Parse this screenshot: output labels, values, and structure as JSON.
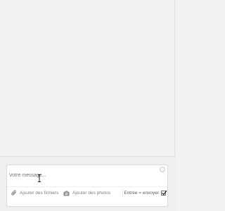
{
  "composer": {
    "message_placeholder": "Votre message...",
    "attach_label": "Ajouter des fichiers",
    "photo_label": "Ajouter des photos",
    "enter_to_send_label": "Entrée = envoyer",
    "enter_to_send_checked": true
  },
  "icons": {
    "attach": "paperclip-icon",
    "photo": "camera-icon",
    "emoji": "emoji-icon",
    "cursor": "text-cursor-icon"
  },
  "colors": {
    "background": "#f1f2f4",
    "composer_background": "#eeeff1",
    "input_background": "#ffffff",
    "label_gray": "#7b7f84"
  }
}
